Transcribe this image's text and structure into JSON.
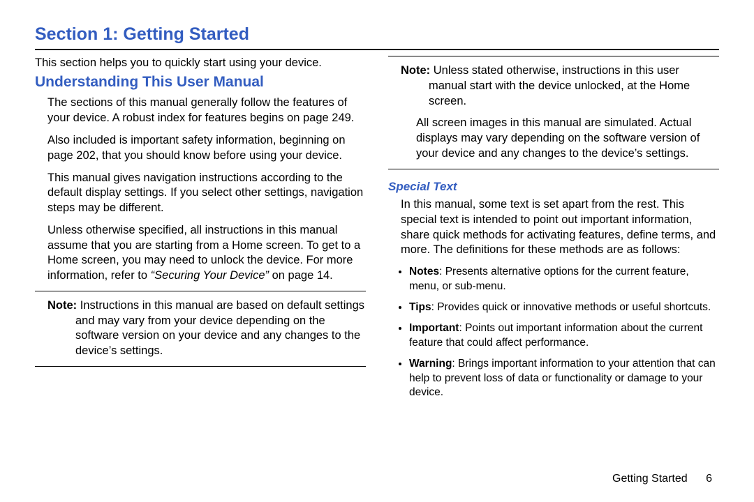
{
  "title": "Section 1: Getting Started",
  "left": {
    "intro": "This section helps you to quickly start using your device.",
    "h2": "Understanding This User Manual",
    "p1": "The sections of this manual generally follow the features of your device. A robust index for features begins on page 249.",
    "p2": "Also included is important safety information, beginning on page 202, that you should know before using your device.",
    "p3": "This manual gives navigation instructions according to the default display settings. If you select other settings, navigation steps may be different.",
    "p4a": "Unless otherwise specified, all instructions in this manual assume that you are starting from a Home screen. To get to a Home screen, you may need to unlock the device. For more information, refer to ",
    "p4ref": "“Securing Your Device”",
    "p4b": "  on page 14.",
    "note1_label": "Note:",
    "note1_text": " Instructions in this manual are based on default settings and may vary from your device depending on the software version on your device and any changes to the device’s settings."
  },
  "right": {
    "note2_label": "Note:",
    "note2_text": " Unless stated otherwise, instructions in this user manual start with the device unlocked, at the Home screen.",
    "p5": "All screen images in this manual are simulated. Actual displays may vary depending on the software version of your device and any changes to the device’s settings.",
    "h3": "Special Text",
    "p6": "In this manual, some text is set apart from the rest. This special text is intended to point out important information, share quick methods for activating features, define terms, and more. The definitions for these methods are as follows:",
    "defs": [
      {
        "term": "Notes",
        "text": ": Presents alternative options for the current feature, menu, or sub-menu."
      },
      {
        "term": "Tips",
        "text": ": Provides quick or innovative methods or useful shortcuts."
      },
      {
        "term": "Important",
        "text": ": Points out important information about the current feature that could affect performance."
      },
      {
        "term": "Warning",
        "text": ": Brings important information to your attention that can help to prevent loss of data or functionality or damage to your device."
      }
    ]
  },
  "footer": {
    "label": "Getting Started",
    "page": "6"
  }
}
